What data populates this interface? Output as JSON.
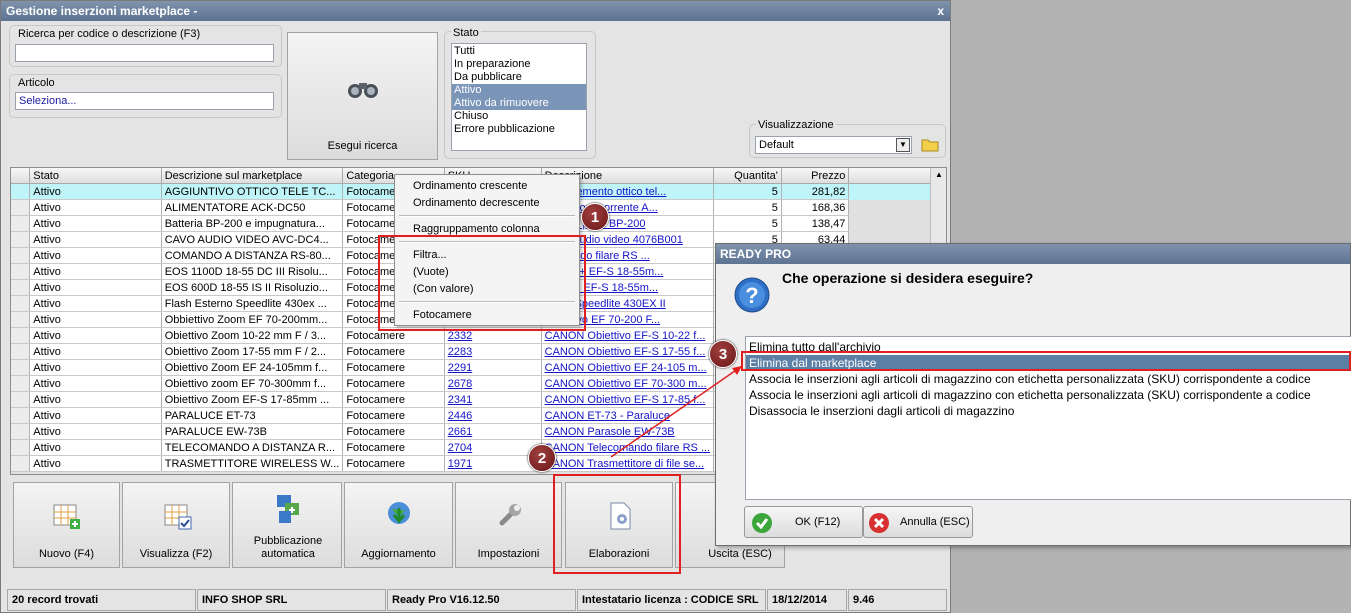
{
  "window": {
    "title": "Gestione inserzioni marketplace -",
    "close_glyph": "x"
  },
  "search": {
    "label": "Ricerca per codice o descrizione (F3)",
    "value": ""
  },
  "article": {
    "label": "Articolo",
    "value": "Seleziona..."
  },
  "search_button": {
    "label": "Esegui ricerca"
  },
  "status_filter": {
    "label": "Stato",
    "items": [
      {
        "label": "Tutti",
        "selected": false
      },
      {
        "label": "In preparazione",
        "selected": false
      },
      {
        "label": "Da pubblicare",
        "selected": false
      },
      {
        "label": "Attivo",
        "selected": true
      },
      {
        "label": "Attivo da rimuovere",
        "selected": true
      },
      {
        "label": "Chiuso",
        "selected": false
      },
      {
        "label": "Errore pubblicazione",
        "selected": false
      }
    ]
  },
  "view": {
    "label": "Visualizzazione",
    "value": "Default"
  },
  "grid": {
    "columns": [
      "Stato",
      "Descrizione sul marketplace",
      "Categoria",
      "SKU",
      "Descrizione",
      "Quantita'",
      "Prezzo"
    ],
    "rows": [
      {
        "stato": "Attivo",
        "desc_mp": "AGGIUNTIVO OTTICO TELE TC...",
        "cat": "Fotocamere",
        "sku": "",
        "desc": "Complemento ottico tel...",
        "qty": "5",
        "price": "281,82"
      },
      {
        "stato": "Attivo",
        "desc_mp": "ALIMENTATORE ACK-DC50",
        "cat": "Fotocamere",
        "sku": "",
        "desc": "Adattatore corrente A...",
        "qty": "5",
        "price": "168,36"
      },
      {
        "stato": "Attivo",
        "desc_mp": "Batteria BP-200 e impugnatura...",
        "cat": "Fotocamere",
        "sku": "",
        "desc": "Battery pack BP-200",
        "qty": "5",
        "price": "138,47"
      },
      {
        "stato": "Attivo",
        "desc_mp": "CAVO AUDIO VIDEO AVC-DC4...",
        "cat": "Fotocamere",
        "sku": "",
        "desc": "Cavo audio video 4076B001",
        "qty": "5",
        "price": "63,44"
      },
      {
        "stato": "Attivo",
        "desc_mp": "COMANDO A DISTANZA RS-80...",
        "cat": "Fotocamere",
        "sku": "",
        "desc": "Comando filare RS ...",
        "qty": "",
        "price": ""
      },
      {
        "stato": "Attivo",
        "desc_mp": "EOS 1100D 18-55 DC III Risolu...",
        "cat": "Fotocamere",
        "sku": "",
        "desc": "1100D + EF-S 18-55m...",
        "qty": "",
        "price": ""
      },
      {
        "stato": "Attivo",
        "desc_mp": "EOS 600D 18-55 IS II Risoluzio...",
        "cat": "Fotocamere",
        "sku": "",
        "desc": "600D + EF-S 18-55m...",
        "qty": "",
        "price": ""
      },
      {
        "stato": "Attivo",
        "desc_mp": "Flash Esterno Speedlite 430ex ...",
        "cat": "Fotocamere",
        "sku": "",
        "desc": "Flash Speedlite 430EX II",
        "qty": "",
        "price": ""
      },
      {
        "stato": "Attivo",
        "desc_mp": "Obbiettivo Zoom EF 70-200mm...",
        "cat": "Fotocamere",
        "sku": "",
        "desc": "Obiettivo EF 70-200 F...",
        "qty": "",
        "price": ""
      },
      {
        "stato": "Attivo",
        "desc_mp": "Obiettivo Zoom 10-22 mm F / 3...",
        "cat": "Fotocamere",
        "sku": "2332",
        "desc": "CANON Obiettivo EF-S 10-22 f...",
        "qty": "",
        "price": ""
      },
      {
        "stato": "Attivo",
        "desc_mp": "Obiettivo Zoom 17-55 mm F / 2...",
        "cat": "Fotocamere",
        "sku": "2283",
        "desc": "CANON Obiettivo EF-S 17-55 f...",
        "qty": "",
        "price": ""
      },
      {
        "stato": "Attivo",
        "desc_mp": "Obiettivo Zoom EF 24-105mm f...",
        "cat": "Fotocamere",
        "sku": "2291",
        "desc": "CANON Obiettivo EF 24-105 m...",
        "qty": "",
        "price": ""
      },
      {
        "stato": "Attivo",
        "desc_mp": "Obiettivo zoom EF 70-300mm f...",
        "cat": "Fotocamere",
        "sku": "2678",
        "desc": "CANON Obiettivo EF 70-300 m...",
        "qty": "",
        "price": ""
      },
      {
        "stato": "Attivo",
        "desc_mp": "Obiettivo Zoom EF-S 17-85mm ...",
        "cat": "Fotocamere",
        "sku": "2341",
        "desc": "CANON Obiettivo EF-S 17-85 f...",
        "qty": "",
        "price": ""
      },
      {
        "stato": "Attivo",
        "desc_mp": "PARALUCE ET-73",
        "cat": "Fotocamere",
        "sku": "2446",
        "desc": "CANON ET-73 - Paraluce",
        "qty": "",
        "price": ""
      },
      {
        "stato": "Attivo",
        "desc_mp": "PARALUCE EW-73B",
        "cat": "Fotocamere",
        "sku": "2661",
        "desc": "CANON Parasole EW-73B",
        "qty": "",
        "price": ""
      },
      {
        "stato": "Attivo",
        "desc_mp": "TELECOMANDO A DISTANZA R...",
        "cat": "Fotocamere",
        "sku": "2704",
        "desc": "CANON Telecomando filare RS ...",
        "qty": "",
        "price": ""
      },
      {
        "stato": "Attivo",
        "desc_mp": "TRASMETTITORE WIRELESS W...",
        "cat": "Fotocamere",
        "sku": "1971",
        "desc": "CANON Trasmettitore di file se...",
        "qty": "",
        "price": ""
      }
    ]
  },
  "context_menu": {
    "items": [
      "Ordinamento crescente",
      "Ordinamento decrescente",
      "Raggruppamento colonna",
      "Filtra...",
      "(Vuote)",
      "(Con valore)",
      "Fotocamere"
    ]
  },
  "toolbar": {
    "nuovo": "Nuovo (F4)",
    "visualizza": "Visualizza (F2)",
    "pubblicazione": "Pubblicazione automatica",
    "aggiornamento": "Aggiornamento",
    "impostazioni": "Impostazioni",
    "elaborazioni": "Elaborazioni",
    "uscita": "Uscita (ESC)"
  },
  "status": {
    "records": "20 record trovati",
    "company": "INFO SHOP SRL",
    "version": "Ready Pro V16.12.50",
    "license": "Intestatario licenza : CODICE SRL",
    "date": "18/12/2014",
    "time": "9.46"
  },
  "dialog": {
    "title": "READY PRO",
    "question": "Che operazione si desidera eseguire?",
    "options": [
      {
        "label": "Elimina tutto dall'archivio",
        "selected": false
      },
      {
        "label": "Elimina dal marketplace",
        "selected": true
      },
      {
        "label": "Associa le inserzioni agli articoli di magazzino con etichetta personalizzata (SKU) corrispondente a codice",
        "selected": false
      },
      {
        "label": "Associa le inserzioni agli articoli di magazzino con etichetta personalizzata (SKU) corrispondente a codice",
        "selected": false
      },
      {
        "label": "Disassocia le inserzioni dagli articoli di magazzino",
        "selected": false
      }
    ],
    "ok": "OK (F12)",
    "cancel": "Annulla (ESC)"
  },
  "annotations": {
    "step1": "1",
    "step2": "2",
    "step3": "3",
    "color": "#e02020"
  }
}
